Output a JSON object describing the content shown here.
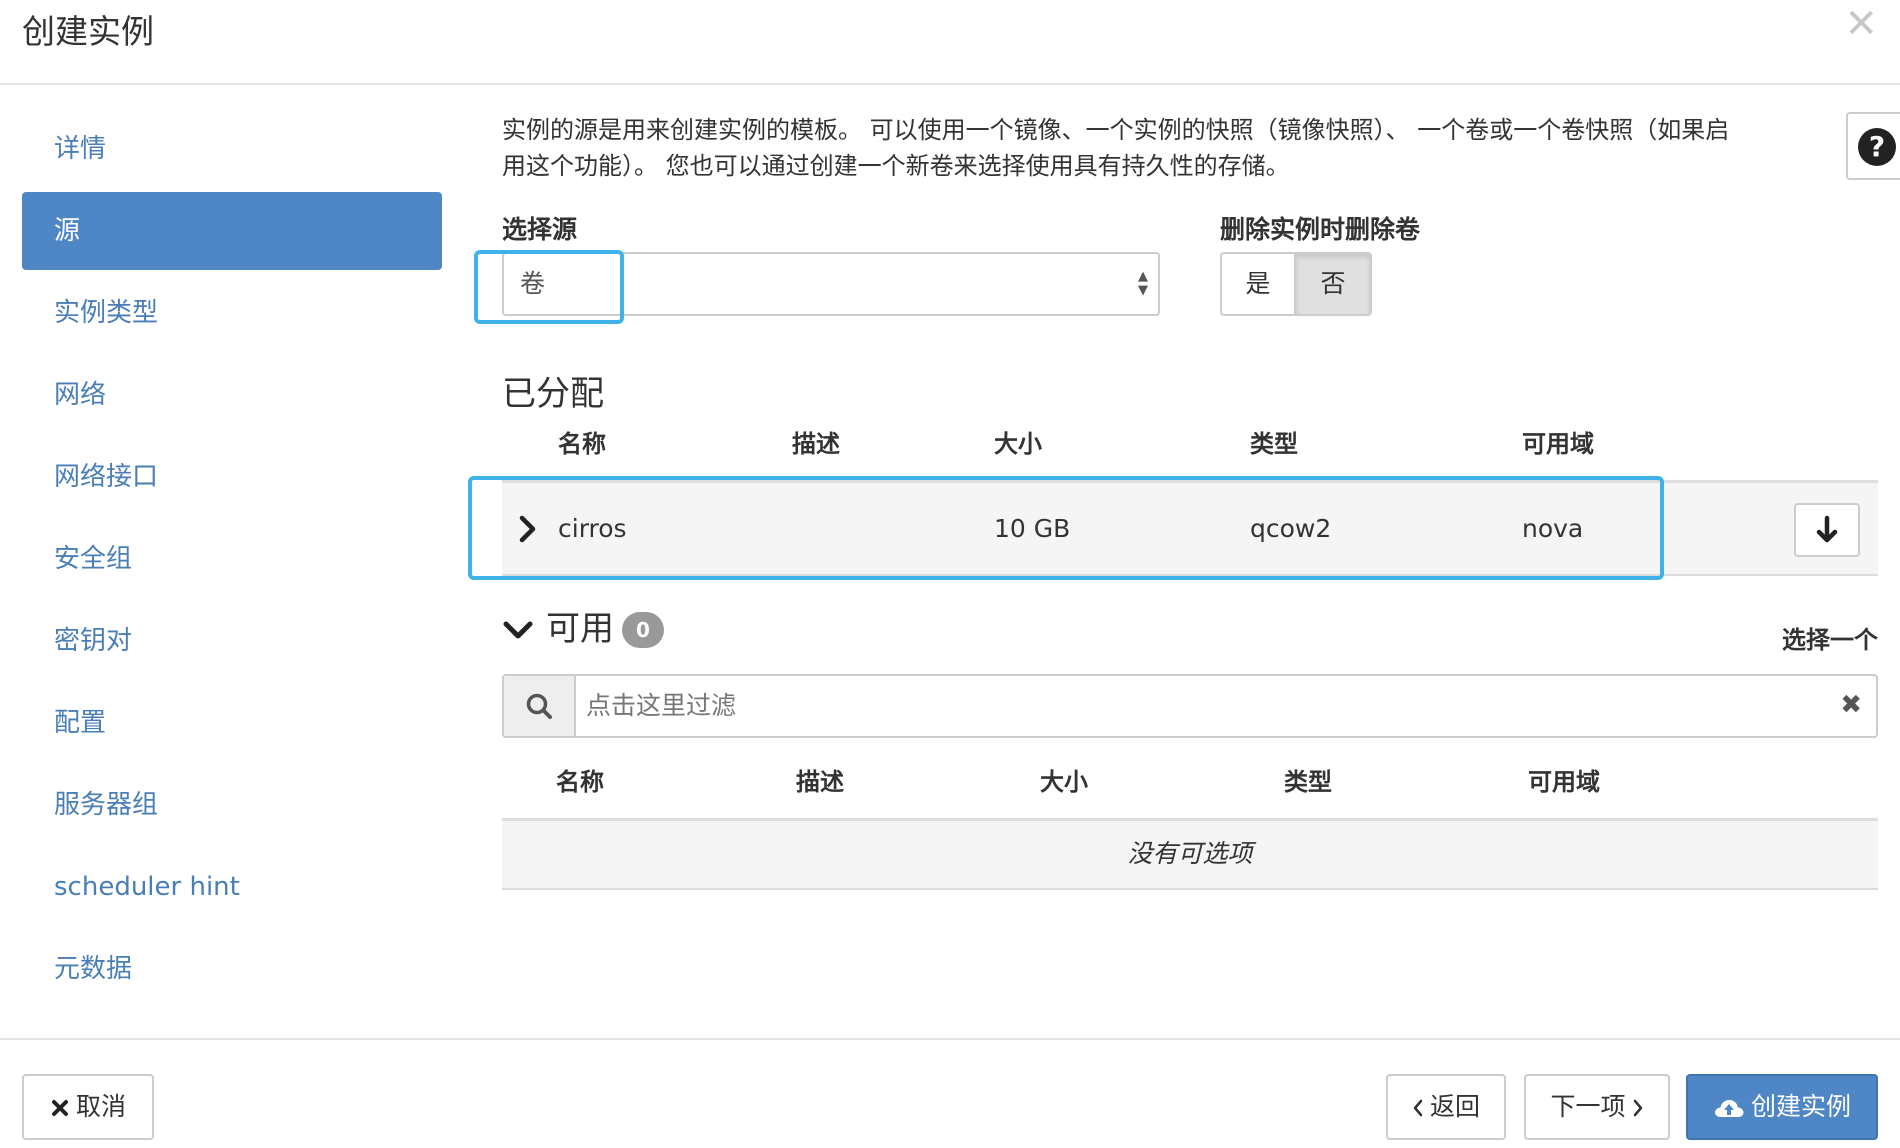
{
  "modal": {
    "title": "创建实例",
    "close_glyph": "✕"
  },
  "sidebar": {
    "items": [
      {
        "label": "详情",
        "active": false
      },
      {
        "label": "源",
        "active": true
      },
      {
        "label": "实例类型",
        "active": false
      },
      {
        "label": "网络",
        "active": false
      },
      {
        "label": "网络接口",
        "active": false
      },
      {
        "label": "安全组",
        "active": false
      },
      {
        "label": "密钥对",
        "active": false
      },
      {
        "label": "配置",
        "active": false
      },
      {
        "label": "服务器组",
        "active": false
      },
      {
        "label": "scheduler hint",
        "active": false
      },
      {
        "label": "元数据",
        "active": false
      }
    ]
  },
  "source": {
    "description_line1": "实例的源是用来创建实例的模板。 可以使用一个镜像、一个实例的快照（镜像快照）、 一个卷或一个卷快照（如果启",
    "description_line2": "用这个功能）。 您也可以通过创建一个新卷来选择使用具有持久性的存储。",
    "help_glyph": "?",
    "select_label": "选择源",
    "select_value": "卷",
    "delete_label": "删除实例时删除卷",
    "delete_yes": "是",
    "delete_no": "否",
    "delete_selected": "否"
  },
  "allocated": {
    "title": "已分配",
    "columns": [
      "名称",
      "描述",
      "大小",
      "类型",
      "可用域"
    ],
    "rows": [
      {
        "name": "cirros",
        "description": "",
        "size": "10 GB",
        "type": "qcow2",
        "zone": "nova"
      }
    ]
  },
  "available": {
    "title": "可用",
    "count": "0",
    "select_one": "选择一个",
    "search_placeholder": "点击这里过滤",
    "clear_glyph": "✖",
    "columns": [
      "名称",
      "描述",
      "大小",
      "类型",
      "可用域"
    ],
    "empty_text": "没有可选项"
  },
  "footer": {
    "cancel_label": "取消",
    "back_label": "返回",
    "next_label": "下一项",
    "create_label": "创建实例"
  },
  "colors": {
    "accent": "#4f86c6",
    "link": "#4a7eb6",
    "highlight": "#3fb2e7"
  }
}
